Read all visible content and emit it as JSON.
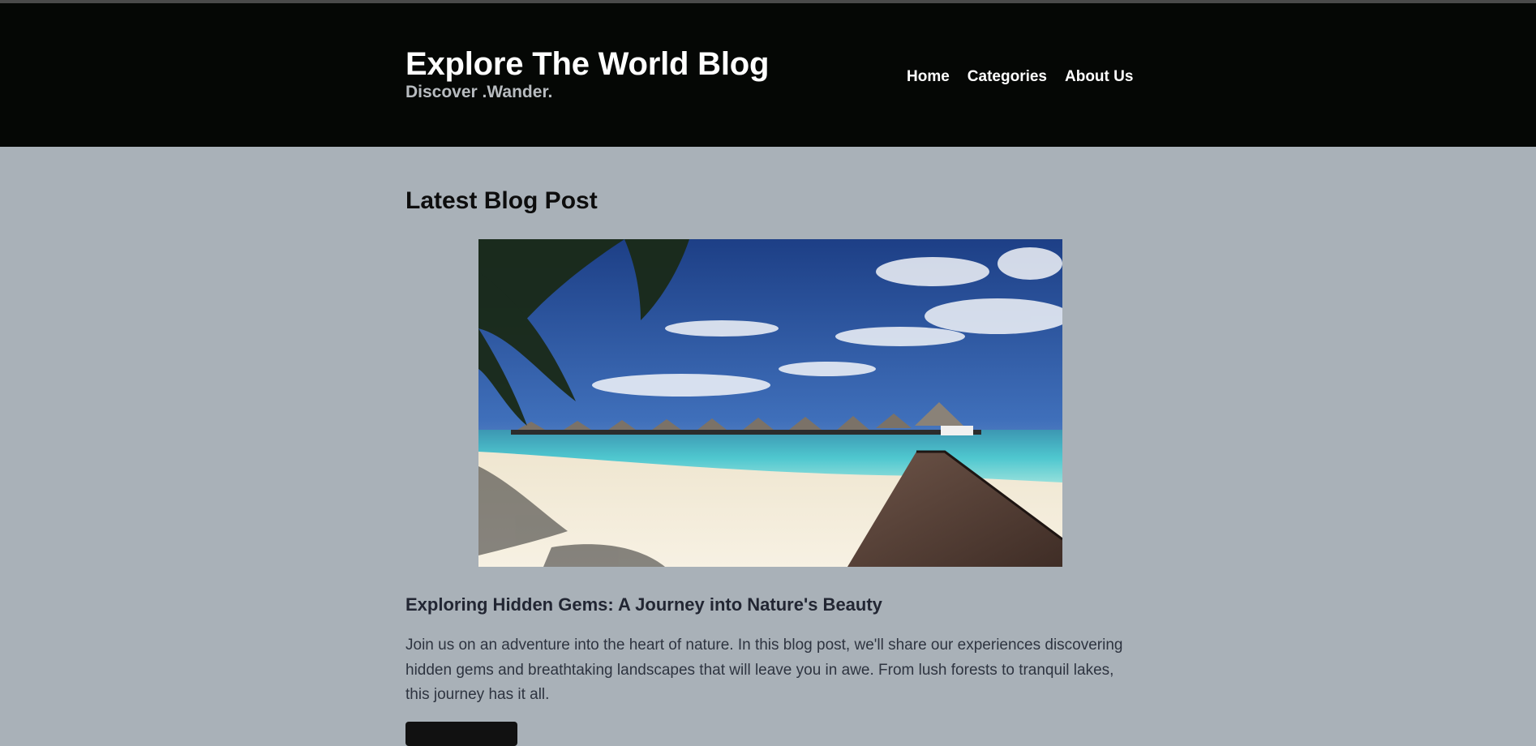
{
  "header": {
    "title": "Explore The World Blog",
    "tagline": "Discover .Wander."
  },
  "nav": {
    "items": [
      "Home",
      "Categories",
      "About Us"
    ]
  },
  "main": {
    "section_title": "Latest Blog Post",
    "post": {
      "image_alt": "Overwater bungalows along a wooden pier on a tropical beach",
      "title": "Exploring Hidden Gems: A Journey into Nature's Beauty",
      "excerpt": "Join us on an adventure into the heart of nature. In this blog post, we'll share our experiences discovering hidden gems and breathtaking landscapes that will leave you in awe. From lush forests to tranquil lakes, this journey has it all."
    }
  },
  "colors": {
    "header_bg": "#050705",
    "page_bg": "#a9b1b8",
    "heading": "#0d0d0d",
    "body_text": "#2e3440"
  }
}
